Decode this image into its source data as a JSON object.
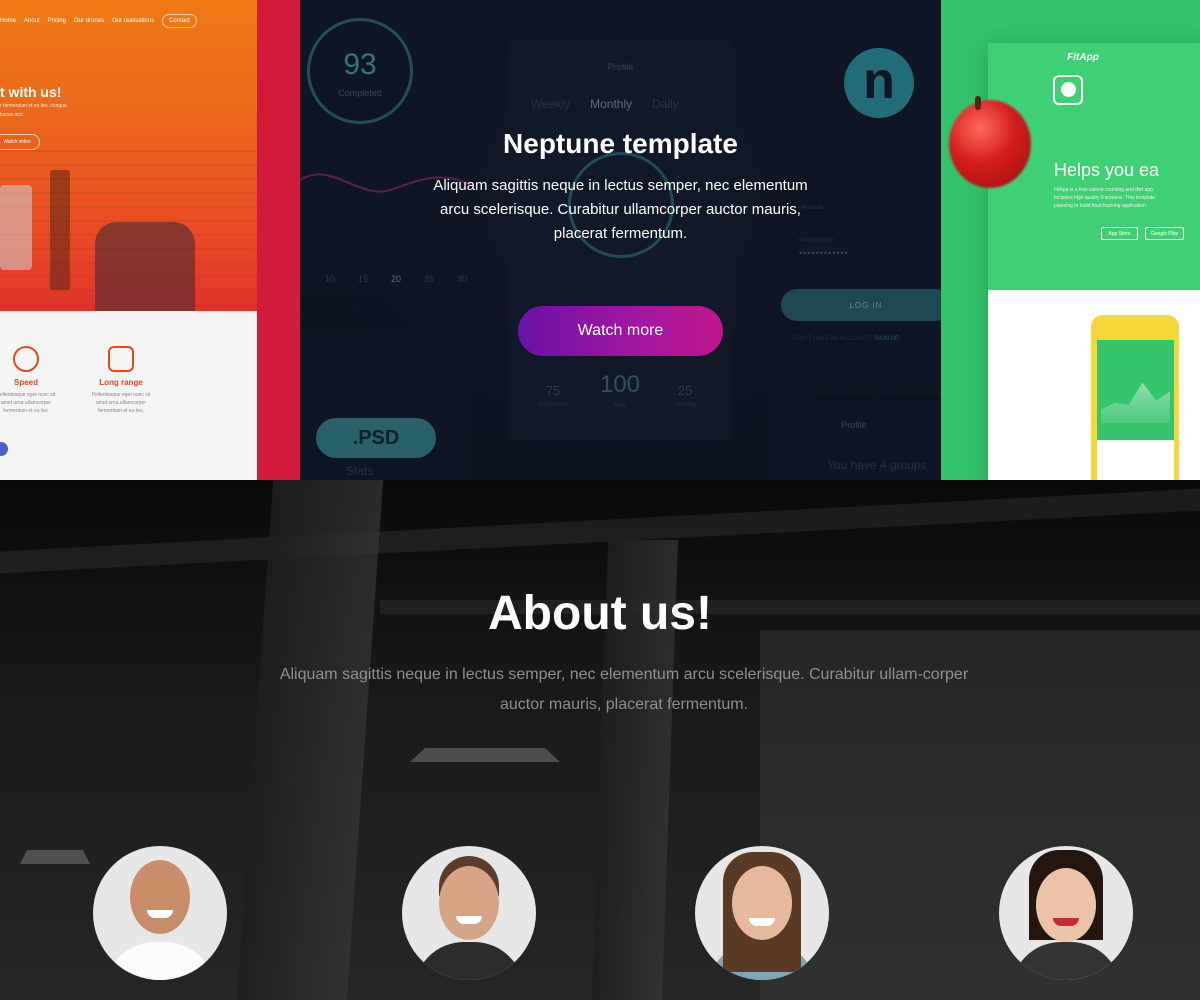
{
  "orange_template": {
    "nav": [
      "Home",
      "About",
      "Pricing",
      "Our drones",
      "Our realisations",
      "Contact"
    ],
    "title": "t with us!",
    "subtitle": "r fermentum et eu leo. congue, luctus orci",
    "button": "Watch video",
    "features": [
      {
        "title": "Speed",
        "text": "Pellentesque eget nunc sit amet urna ullamcorper fermentum et eu leo."
      },
      {
        "title": "Long range",
        "text": "Pellentesque eget nunc sit amet urna ullamcorper fermentum et eu leo."
      }
    ]
  },
  "neptune_preview": {
    "ring_value": "93",
    "ring_label": "Completed",
    "axis_ticks": [
      "10",
      "15",
      "20",
      "25",
      "30"
    ],
    "profile_header": "Profile",
    "tabs": [
      "Weekly",
      "Monthly",
      "Daily"
    ],
    "active_tab": "Monthly",
    "stats": [
      {
        "value": "75",
        "label": "Completed"
      },
      {
        "value": "100",
        "label": "Total"
      },
      {
        "value": "25",
        "label": "Pending"
      }
    ],
    "logo_letter": "n",
    "username": "ryk.wasik",
    "password_label": "PASSWORD",
    "password_mask": "••••••••••••",
    "login_button": "LOG IN",
    "signup_prompt": "DON'T HAVE AN ACCOUNT?",
    "signup_link": "SIGN UP",
    "psd_badge": ".PSD",
    "stats_label": "Stats",
    "groups_header": "Profile",
    "groups_text": "You have 4 groups"
  },
  "hero": {
    "title": "Neptune template",
    "text": "Aliquam sagittis neque in lectus semper, nec elementum arcu scelerisque. Curabitur ullamcorper auctor mauris, placerat fermentum.",
    "button": "Watch more",
    "button_colors": [
      "#6a12a8",
      "#c0168c"
    ]
  },
  "fitapp": {
    "title": "FitApp",
    "heading": "Helps you ea",
    "text": "FitApp is a free calorie counting and diet app. Includes high quality 9 screens. This template planning to build food tracking application.",
    "app_store": "App Store",
    "google_play": "Google Play"
  },
  "about": {
    "title": "About us!",
    "text": "Aliquam sagittis neque in lectus semper, nec elementum arcu scelerisque. Curabitur ullam-corper auctor mauris, placerat fermentum."
  }
}
